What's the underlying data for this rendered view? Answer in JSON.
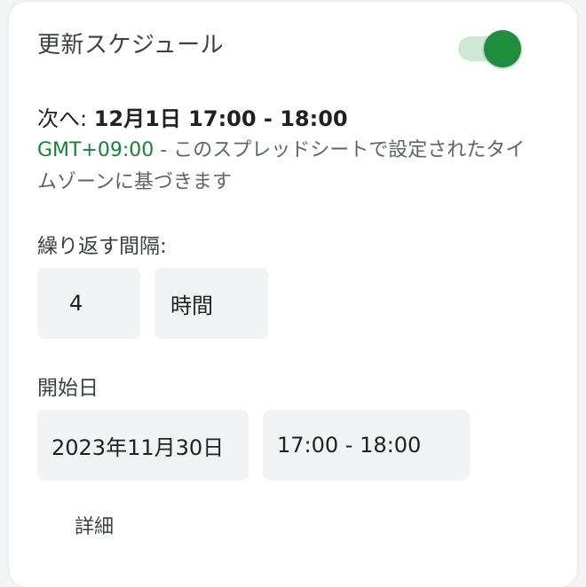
{
  "schedule": {
    "title": "更新スケジュール",
    "enabled": true,
    "next_label": "次へ: ",
    "next_value": "12月1日 17:00 - 18:00",
    "timezone_gmt": "GMT+09:00",
    "timezone_text": " - このスプレッドシートで設定されたタイムゾーンに基づきます"
  },
  "repeat": {
    "label": "繰り返す間隔:",
    "interval_value": "4",
    "interval_unit": "時間"
  },
  "start": {
    "label": "開始日",
    "date": "2023年11月30日",
    "time_range": "17:00 - 18:00"
  },
  "details_label": "詳細",
  "colors": {
    "toggle_on": "#1e8e3e",
    "toggle_track": "#cfe8d5",
    "gmt": "#188038"
  },
  "icons": {
    "toggle": "toggle-switch-on"
  }
}
